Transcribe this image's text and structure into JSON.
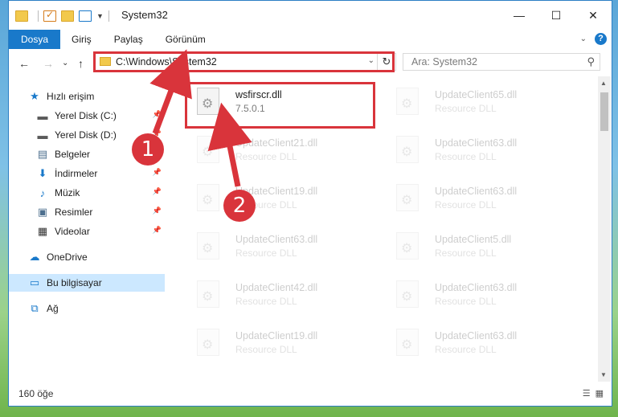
{
  "window": {
    "title": "System32",
    "controls": {
      "minimize": "—",
      "maximize": "☐",
      "close": "✕"
    }
  },
  "ribbon": {
    "tabs": [
      "Dosya",
      "Giriş",
      "Paylaş",
      "Görünüm"
    ],
    "active_tab": "Dosya",
    "help": "?"
  },
  "navigation": {
    "back": "←",
    "forward": "→",
    "recent": "⌄",
    "up": "↑",
    "address": "C:\\Windows\\System32",
    "refresh": "↻",
    "search_placeholder": "Ara: System32",
    "search_icon": "search-icon"
  },
  "sidebar": {
    "items": [
      {
        "label": "Hızlı erişim",
        "icon": "star-icon",
        "glyph": "★",
        "color": "#1979ca"
      },
      {
        "label": "Yerel Disk (C:)",
        "icon": "drive-icon",
        "glyph": "▬",
        "color": "#5a5a5a",
        "pinned": true
      },
      {
        "label": "Yerel Disk (D:)",
        "icon": "drive-icon",
        "glyph": "▬",
        "color": "#5a5a5a",
        "pinned": true
      },
      {
        "label": "Belgeler",
        "icon": "documents-icon",
        "glyph": "▤",
        "color": "#4d6f8e",
        "pinned": true
      },
      {
        "label": "İndirmeler",
        "icon": "download-icon",
        "glyph": "⬇",
        "color": "#1979ca",
        "pinned": true
      },
      {
        "label": "Müzik",
        "icon": "music-icon",
        "glyph": "♪",
        "color": "#1979ca",
        "pinned": true
      },
      {
        "label": "Resimler",
        "icon": "pictures-icon",
        "glyph": "▣",
        "color": "#4d6f8e",
        "pinned": true
      },
      {
        "label": "Videolar",
        "icon": "videos-icon",
        "glyph": "▦",
        "color": "#333333",
        "pinned": true
      },
      {
        "label": "OneDrive",
        "icon": "cloud-icon",
        "glyph": "☁",
        "color": "#1979ca"
      },
      {
        "label": "Bu bilgisayar",
        "icon": "computer-icon",
        "glyph": "▭",
        "color": "#1979ca",
        "selected": true
      },
      {
        "label": "Ağ",
        "icon": "network-icon",
        "glyph": "⧉",
        "color": "#1979ca"
      }
    ]
  },
  "files": [
    {
      "name": "wsfirscr.dll",
      "desc": "7.5.0.1",
      "highlighted": true
    },
    {
      "name": "UpdateClient65.dll",
      "desc": "Resource DLL"
    },
    {
      "name": "UpdateClient21.dll",
      "desc": "Resource DLL"
    },
    {
      "name": "UpdateClient63.dll",
      "desc": "Resource DLL"
    },
    {
      "name": "UpdateClient19.dll",
      "desc": "Resource DLL"
    },
    {
      "name": "UpdateClient63.dll",
      "desc": "Resource DLL"
    },
    {
      "name": "UpdateClient63.dll",
      "desc": "Resource DLL"
    },
    {
      "name": "UpdateClient5.dll",
      "desc": "Resource DLL"
    },
    {
      "name": "UpdateClient42.dll",
      "desc": "Resource DLL"
    },
    {
      "name": "UpdateClient63.dll",
      "desc": "Resource DLL"
    },
    {
      "name": "UpdateClient19.dll",
      "desc": "Resource DLL"
    },
    {
      "name": "UpdateClient63.dll",
      "desc": "Resource DLL"
    }
  ],
  "status": {
    "count": "160 öğe"
  },
  "annotations": {
    "step1": "1",
    "step2": "2",
    "color": "#d9343b"
  }
}
